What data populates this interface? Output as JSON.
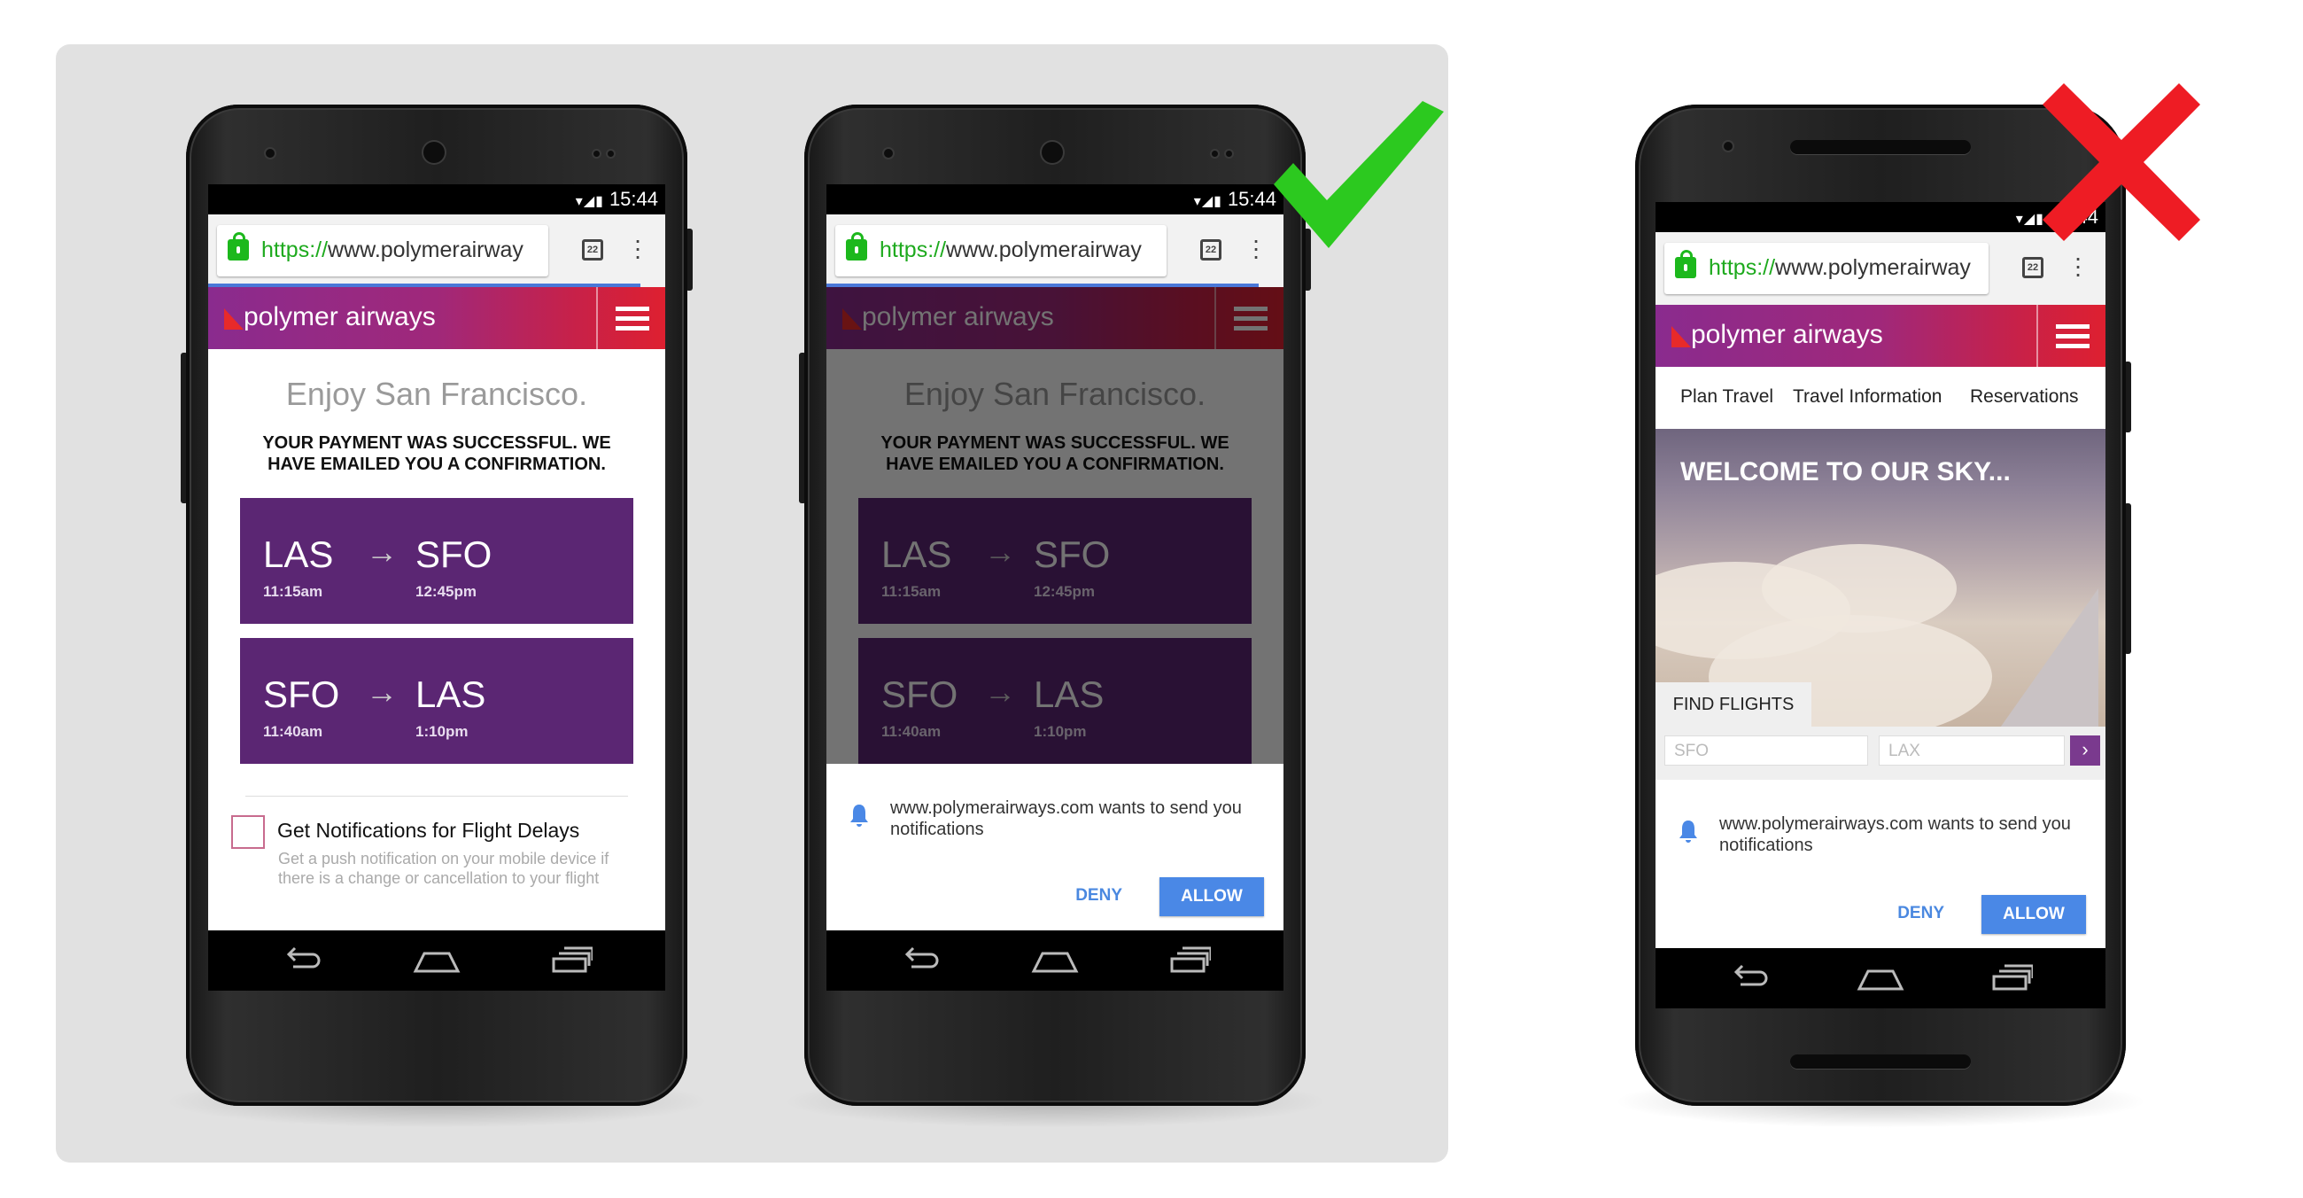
{
  "status": {
    "time": "15:44",
    "icons": "▾◢▮"
  },
  "browser": {
    "url_proto": "https://",
    "url_rest": "www.polymerairway",
    "tab_count": "22"
  },
  "site": {
    "brand": "polymer airways",
    "enjoy": "Enjoy San Francisco.",
    "payment_line1": "YOUR PAYMENT WAS SUCCESSFUL. WE",
    "payment_line2": "HAVE EMAILED YOU A CONFIRMATION.",
    "flights": [
      {
        "from": "LAS",
        "to": "SFO",
        "arrow": "→",
        "from_time": "11:15am",
        "to_time": "12:45pm"
      },
      {
        "from": "SFO",
        "to": "LAS",
        "arrow": "→",
        "from_time": "11:40am",
        "to_time": "1:10pm"
      }
    ],
    "notif_title": "Get Notifications for Flight Delays",
    "notif_desc": "Get a push notification on your mobile device if there is a change or cancellation to your flight"
  },
  "prompt": {
    "message": "www.polymerairways.com wants to send you notifications",
    "deny": "DENY",
    "allow": "ALLOW"
  },
  "home_page": {
    "tabs": [
      "Plan Travel",
      "Travel Information",
      "Reservations"
    ],
    "welcome": "WELCOME TO OUR SKY...",
    "find_flights": "FIND FLIGHTS",
    "from_placeholder": "SFO",
    "to_placeholder": "LAX",
    "go": "›"
  },
  "marks": {
    "good": "✔",
    "bad": "✖"
  },
  "colors": {
    "good": "#25c81e",
    "bad": "#ee1c24",
    "header_start": "#8a2b8e",
    "header_end": "#de2030",
    "flight_card": "#5b2673",
    "allow": "#4a88e6"
  }
}
